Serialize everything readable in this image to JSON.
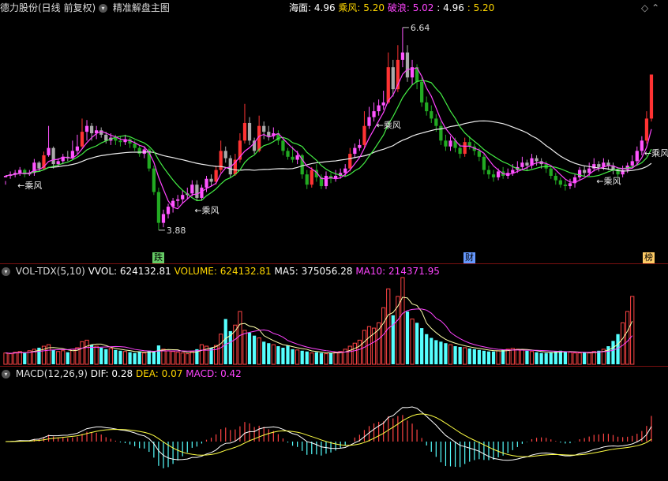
{
  "header": {
    "stock_name": "德力股份(日线 前复权)",
    "indicator_name": "精准解盘主图",
    "indicators": [
      {
        "label": "海面:",
        "value": "4.96",
        "color": "#ffffff"
      },
      {
        "label": "乘风:",
        "value": "5.20",
        "color": "#ffd700"
      },
      {
        "label": "破浪:",
        "value": "5.02",
        "color": "#ff44ff"
      },
      {
        "label": ":",
        "value": "4.96",
        "color": "#ffffff"
      },
      {
        "label": ":",
        "value": "5.20",
        "color": "#ffd700"
      }
    ]
  },
  "main_chart": {
    "high_label": "6.64",
    "low_label": "3.88",
    "signal_label": "乘风",
    "badges": [
      {
        "text": "跌",
        "color": "#66cc66"
      },
      {
        "text": "财",
        "color": "#6699ff"
      },
      {
        "text": "榜",
        "color": "#ffcc66"
      }
    ]
  },
  "volume_panel": {
    "title": "VOL-TDX(5,10)",
    "items": [
      {
        "label": "VVOL:",
        "value": "624132.81",
        "color": "#ffffff"
      },
      {
        "label": "VOLUME:",
        "value": "624132.81",
        "color": "#ffd700"
      },
      {
        "label": "MA5:",
        "value": "375056.28",
        "color": "#ffffff"
      },
      {
        "label": "MA10:",
        "value": "214371.95",
        "color": "#ff44ff"
      }
    ]
  },
  "macd_panel": {
    "title": "MACD(12,26,9)",
    "items": [
      {
        "label": "DIF:",
        "value": "0.28",
        "color": "#ffffff"
      },
      {
        "label": "DEA:",
        "value": "0.07",
        "color": "#ffd700"
      },
      {
        "label": "MACD:",
        "value": "0.42",
        "color": "#ff44ff"
      }
    ]
  },
  "chart_data": {
    "type": "candlestick",
    "price_range": [
      3.6,
      6.8
    ],
    "candles": [
      [
        4.6,
        4.62,
        4.55,
        4.5
      ],
      [
        4.62,
        4.64,
        4.68,
        4.58
      ],
      [
        4.64,
        4.66,
        4.7,
        4.6
      ],
      [
        4.66,
        4.7,
        4.74,
        4.62
      ],
      [
        4.7,
        4.64,
        4.72,
        4.6
      ],
      [
        4.64,
        4.66,
        4.7,
        4.62
      ],
      [
        4.66,
        4.8,
        4.85,
        4.62
      ],
      [
        4.8,
        4.72,
        4.82,
        4.68
      ],
      [
        4.72,
        4.9,
        4.95,
        4.7
      ],
      [
        4.9,
        5.0,
        5.3,
        4.88
      ],
      [
        5.0,
        4.78,
        5.02,
        4.72
      ],
      [
        4.78,
        4.82,
        4.86,
        4.74
      ],
      [
        4.82,
        4.88,
        4.92,
        4.78
      ],
      [
        4.88,
        4.86,
        4.96,
        4.82
      ],
      [
        4.86,
        4.96,
        5.1,
        4.84
      ],
      [
        4.96,
        5.02,
        5.18,
        4.92
      ],
      [
        5.02,
        5.22,
        5.4,
        5.0
      ],
      [
        5.22,
        5.3,
        5.38,
        5.1
      ],
      [
        5.3,
        5.2,
        5.34,
        5.1
      ],
      [
        5.2,
        5.24,
        5.3,
        5.12
      ],
      [
        5.24,
        5.18,
        5.28,
        5.14
      ],
      [
        5.18,
        5.1,
        5.22,
        5.06
      ],
      [
        5.1,
        5.14,
        5.2,
        5.04
      ],
      [
        5.14,
        5.1,
        5.18,
        5.04
      ],
      [
        5.1,
        5.08,
        5.16,
        5.02
      ],
      [
        5.08,
        5.12,
        5.18,
        5.04
      ],
      [
        5.12,
        5.06,
        5.14,
        5.0
      ],
      [
        5.06,
        5.0,
        5.1,
        4.96
      ],
      [
        5.0,
        4.92,
        5.04,
        4.88
      ],
      [
        4.92,
        4.98,
        5.02,
        4.86
      ],
      [
        4.98,
        4.72,
        5.0,
        4.68
      ],
      [
        4.72,
        4.4,
        4.76,
        4.36
      ],
      [
        4.4,
        3.98,
        4.46,
        3.88
      ],
      [
        3.98,
        4.1,
        4.16,
        3.92
      ],
      [
        4.1,
        4.2,
        4.24,
        4.04
      ],
      [
        4.2,
        4.28,
        4.32,
        4.12
      ],
      [
        4.28,
        4.3,
        4.36,
        4.2
      ],
      [
        4.3,
        4.36,
        4.42,
        4.24
      ],
      [
        4.36,
        4.38,
        4.46,
        4.3
      ],
      [
        4.38,
        4.5,
        4.56,
        4.34
      ],
      [
        4.5,
        4.32,
        4.56,
        4.28
      ],
      [
        4.32,
        4.46,
        4.5,
        4.28
      ],
      [
        4.46,
        4.58,
        4.62,
        4.4
      ],
      [
        4.58,
        4.54,
        4.64,
        4.48
      ],
      [
        4.54,
        4.7,
        4.76,
        4.5
      ],
      [
        4.7,
        4.96,
        5.1,
        4.66
      ],
      [
        4.96,
        4.86,
        5.02,
        4.8
      ],
      [
        4.86,
        4.64,
        4.9,
        4.6
      ],
      [
        4.64,
        4.84,
        4.92,
        4.62
      ],
      [
        4.84,
        5.1,
        5.2,
        4.8
      ],
      [
        5.1,
        5.34,
        5.6,
        5.06
      ],
      [
        5.34,
        5.1,
        5.42,
        5.04
      ],
      [
        5.1,
        4.96,
        5.14,
        4.92
      ],
      [
        4.96,
        5.3,
        5.44,
        4.94
      ],
      [
        5.3,
        5.22,
        5.36,
        5.12
      ],
      [
        5.22,
        5.16,
        5.3,
        5.1
      ],
      [
        5.16,
        5.2,
        5.28,
        5.12
      ],
      [
        5.2,
        5.1,
        5.24,
        5.04
      ],
      [
        5.1,
        4.96,
        5.14,
        4.9
      ],
      [
        4.96,
        4.88,
        5.0,
        4.84
      ],
      [
        4.88,
        4.84,
        5.02,
        4.8
      ],
      [
        4.84,
        4.9,
        4.96,
        4.78
      ],
      [
        4.9,
        4.64,
        4.92,
        4.58
      ],
      [
        4.64,
        4.5,
        4.7,
        4.44
      ],
      [
        4.5,
        4.7,
        4.74,
        4.46
      ],
      [
        4.7,
        4.6,
        4.78,
        4.54
      ],
      [
        4.6,
        4.48,
        4.64,
        4.44
      ],
      [
        4.48,
        4.62,
        4.68,
        4.44
      ],
      [
        4.62,
        4.58,
        4.66,
        4.52
      ],
      [
        4.58,
        4.62,
        4.7,
        4.54
      ],
      [
        4.62,
        4.66,
        4.72,
        4.58
      ],
      [
        4.66,
        4.72,
        4.78,
        4.62
      ],
      [
        4.72,
        4.92,
        5.0,
        4.68
      ],
      [
        4.92,
        5.0,
        5.06,
        4.86
      ],
      [
        5.0,
        5.04,
        5.12,
        4.96
      ],
      [
        5.04,
        5.3,
        5.5,
        5.0
      ],
      [
        5.3,
        5.42,
        5.56,
        5.26
      ],
      [
        5.42,
        5.5,
        5.62,
        5.36
      ],
      [
        5.5,
        5.58,
        5.66,
        5.44
      ],
      [
        5.58,
        5.62,
        5.78,
        5.52
      ],
      [
        5.62,
        6.1,
        6.3,
        5.6
      ],
      [
        6.1,
        5.8,
        6.2,
        5.7
      ],
      [
        5.8,
        6.2,
        6.4,
        5.76
      ],
      [
        6.2,
        6.3,
        6.64,
        6.1
      ],
      [
        6.3,
        5.96,
        6.4,
        5.9
      ],
      [
        5.96,
        6.1,
        6.2,
        5.86
      ],
      [
        6.1,
        5.9,
        6.14,
        5.8
      ],
      [
        5.9,
        5.62,
        5.96,
        5.56
      ],
      [
        5.62,
        5.5,
        5.7,
        5.44
      ],
      [
        5.5,
        5.4,
        5.58,
        5.34
      ],
      [
        5.4,
        5.3,
        5.46,
        5.22
      ],
      [
        5.3,
        5.1,
        5.36,
        5.04
      ],
      [
        5.1,
        5.02,
        5.18,
        4.96
      ],
      [
        5.02,
        5.1,
        5.16,
        4.96
      ],
      [
        5.1,
        5.0,
        5.14,
        4.94
      ],
      [
        5.0,
        4.92,
        5.06,
        4.86
      ],
      [
        4.92,
        5.08,
        5.14,
        4.88
      ],
      [
        5.08,
        5.02,
        5.16,
        4.98
      ],
      [
        5.02,
        4.96,
        5.06,
        4.9
      ],
      [
        4.96,
        4.88,
        5.0,
        4.82
      ],
      [
        4.88,
        4.7,
        4.92,
        4.64
      ],
      [
        4.7,
        4.64,
        4.76,
        4.58
      ],
      [
        4.64,
        4.6,
        4.7,
        4.54
      ],
      [
        4.6,
        4.68,
        4.72,
        4.56
      ],
      [
        4.68,
        4.62,
        4.74,
        4.58
      ],
      [
        4.62,
        4.66,
        4.72,
        4.58
      ],
      [
        4.66,
        4.7,
        4.78,
        4.62
      ],
      [
        4.7,
        4.74,
        4.82,
        4.66
      ],
      [
        4.74,
        4.8,
        4.88,
        4.7
      ],
      [
        4.8,
        4.76,
        4.84,
        4.7
      ],
      [
        4.76,
        4.86,
        4.92,
        4.72
      ],
      [
        4.86,
        4.82,
        4.9,
        4.76
      ],
      [
        4.82,
        4.78,
        4.86,
        4.72
      ],
      [
        4.78,
        4.72,
        4.82,
        4.66
      ],
      [
        4.72,
        4.62,
        4.76,
        4.58
      ],
      [
        4.62,
        4.56,
        4.66,
        4.5
      ],
      [
        4.56,
        4.5,
        4.6,
        4.46
      ],
      [
        4.5,
        4.48,
        4.56,
        4.42
      ],
      [
        4.48,
        4.52,
        4.58,
        4.44
      ],
      [
        4.52,
        4.6,
        4.64,
        4.46
      ],
      [
        4.6,
        4.7,
        4.74,
        4.56
      ],
      [
        4.7,
        4.66,
        4.76,
        4.62
      ],
      [
        4.66,
        4.72,
        4.8,
        4.62
      ],
      [
        4.72,
        4.78,
        4.86,
        4.68
      ],
      [
        4.78,
        4.74,
        4.82,
        4.68
      ],
      [
        4.74,
        4.8,
        4.86,
        4.7
      ],
      [
        4.8,
        4.76,
        4.84,
        4.7
      ],
      [
        4.76,
        4.7,
        4.8,
        4.64
      ],
      [
        4.7,
        4.64,
        4.74,
        4.6
      ],
      [
        4.64,
        4.7,
        4.76,
        4.6
      ],
      [
        4.7,
        4.76,
        4.8,
        4.66
      ],
      [
        4.76,
        4.82,
        4.9,
        4.72
      ],
      [
        4.82,
        4.96,
        5.02,
        4.78
      ],
      [
        4.96,
        5.1,
        5.16,
        4.9
      ],
      [
        5.1,
        5.4,
        5.5,
        5.06
      ],
      [
        5.4,
        6.0,
        6.0,
        5.36
      ]
    ],
    "volume": [
      30,
      28,
      32,
      34,
      30,
      36,
      40,
      44,
      48,
      52,
      38,
      34,
      36,
      32,
      40,
      44,
      60,
      64,
      52,
      48,
      44,
      40,
      42,
      38,
      36,
      34,
      32,
      30,
      34,
      30,
      36,
      34,
      50,
      40,
      36,
      34,
      32,
      30,
      28,
      34,
      40,
      52,
      48,
      44,
      50,
      80,
      120,
      88,
      104,
      140,
      90,
      84,
      76,
      70,
      60,
      56,
      52,
      48,
      44,
      50,
      40,
      38,
      36,
      34,
      30,
      32,
      30,
      28,
      30,
      32,
      34,
      40,
      48,
      56,
      64,
      90,
      100,
      96,
      110,
      150,
      200,
      130,
      180,
      230,
      140,
      120,
      110,
      96,
      80,
      70,
      64,
      60,
      56,
      52,
      48,
      46,
      44,
      42,
      40,
      38,
      36,
      34,
      34,
      36,
      38,
      40,
      42,
      40,
      38,
      36,
      34,
      32,
      30,
      30,
      32,
      34,
      36,
      34,
      32,
      30,
      30,
      32,
      30,
      34,
      36,
      40,
      48,
      62,
      80,
      110,
      140,
      180
    ],
    "volume_ma5": [
      375056.28
    ],
    "volume_ma10": [
      214371.95
    ],
    "macd": {
      "dif": 0.28,
      "dea": 0.07,
      "macd": 0.42
    }
  }
}
